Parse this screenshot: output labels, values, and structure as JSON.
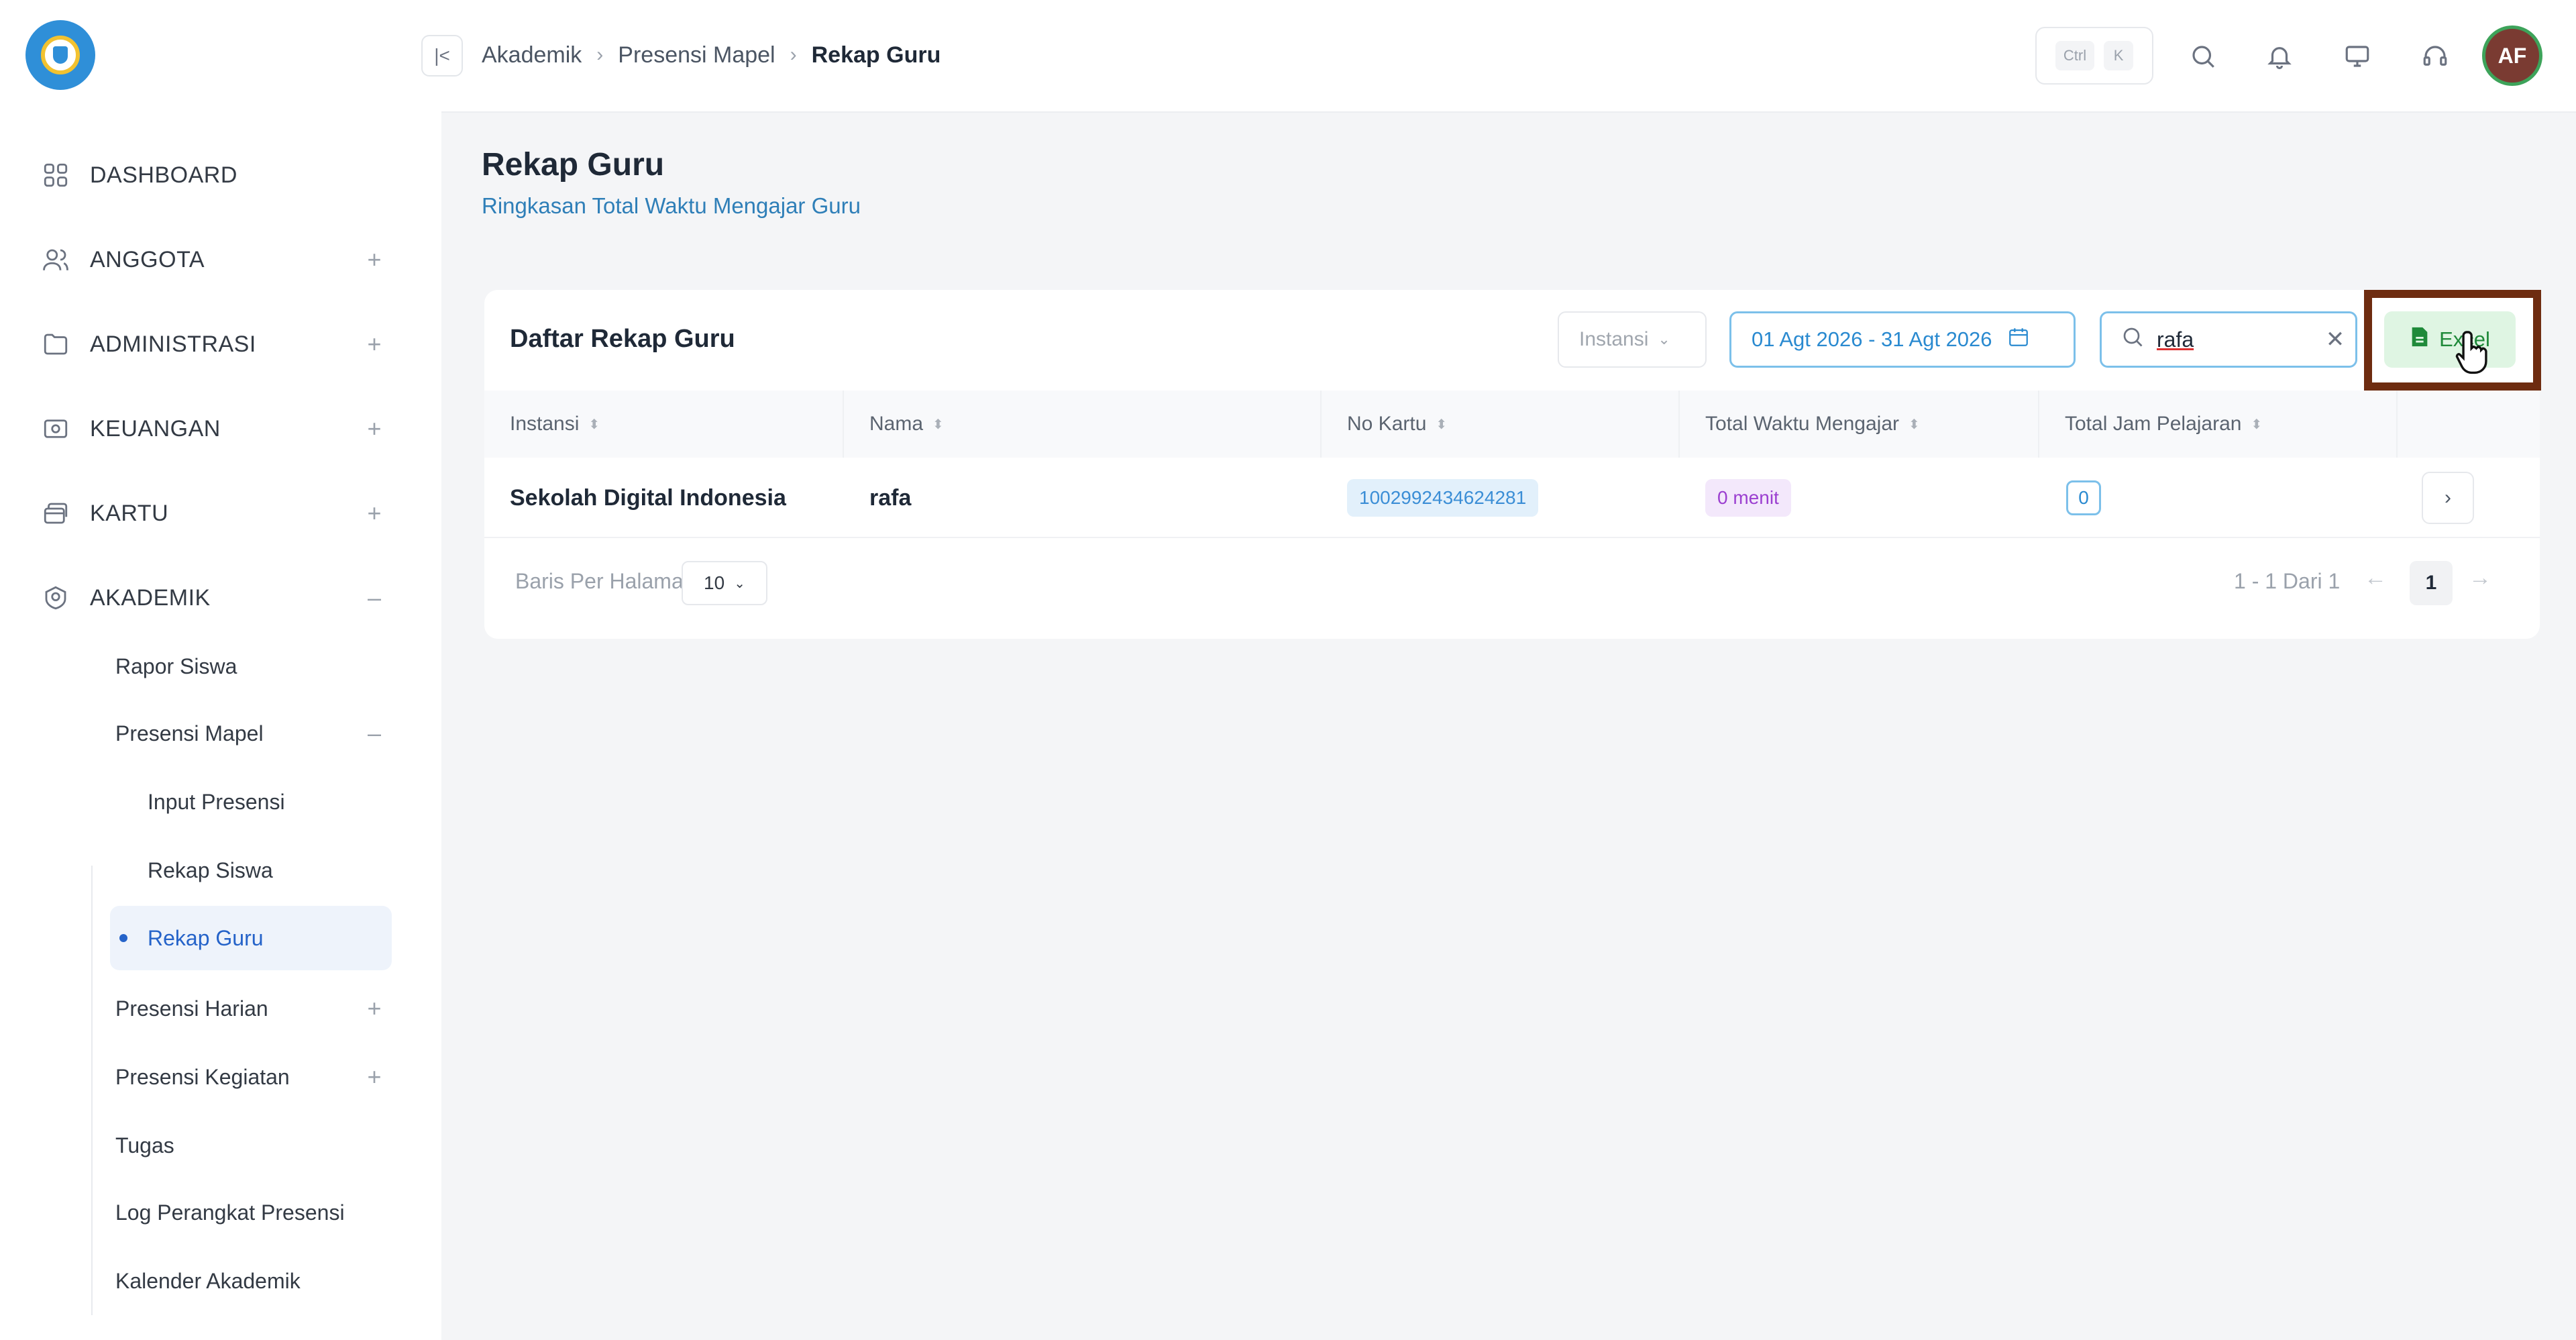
{
  "sidebar": {
    "items": [
      {
        "label": "DASHBOARD",
        "icon": "dashboard-grid-icon"
      },
      {
        "label": "ANGGOTA",
        "icon": "users-icon",
        "toggle": "+"
      },
      {
        "label": "ADMINISTRASI",
        "icon": "folder-icon",
        "toggle": "+"
      },
      {
        "label": "KEUANGAN",
        "icon": "wallet-icon",
        "toggle": "+"
      },
      {
        "label": "KARTU",
        "icon": "cards-icon",
        "toggle": "+"
      },
      {
        "label": "AKADEMIK",
        "icon": "academic-icon",
        "toggle": "–"
      }
    ],
    "akademik_sub": [
      {
        "label": "Rapor Siswa"
      },
      {
        "label": "Presensi Mapel",
        "toggle": "–"
      },
      {
        "label": "Input Presensi"
      },
      {
        "label": "Rekap Siswa"
      },
      {
        "label": "Rekap Guru",
        "active": true
      },
      {
        "label": "Presensi Harian",
        "toggle": "+"
      },
      {
        "label": "Presensi Kegiatan",
        "toggle": "+"
      },
      {
        "label": "Tugas"
      },
      {
        "label": "Log Perangkat Presensi"
      },
      {
        "label": "Kalender Akademik"
      }
    ]
  },
  "header": {
    "breadcrumb": [
      "Akademik",
      "Presensi Mapel",
      "Rekap Guru"
    ],
    "shortcut_keys": [
      "Ctrl",
      "K"
    ],
    "avatar_initials": "AF"
  },
  "page": {
    "title": "Rekap Guru",
    "subtitle": "Ringkasan Total Waktu Mengajar Guru"
  },
  "card": {
    "title": "Daftar Rekap Guru",
    "instansi_placeholder": "Instansi",
    "date_range": "01 Agt 2026 - 31 Agt 2026",
    "search_value": "rafa",
    "excel_label": "Excel"
  },
  "table": {
    "columns": [
      "Instansi",
      "Nama",
      "No Kartu",
      "Total Waktu Mengajar",
      "Total Jam Pelajaran"
    ],
    "rows": [
      {
        "instansi": "Sekolah Digital Indonesia",
        "nama": "rafa",
        "no_kartu": "1002992434624281",
        "total_waktu": "0 menit",
        "total_jam": "0"
      }
    ]
  },
  "pagination": {
    "per_page_label": "Baris Per Halaman",
    "per_page_value": "10",
    "info": "1 - 1 Dari 1",
    "current_page": "1"
  },
  "colors": {
    "accent_blue": "#2a8ad0",
    "excel_green": "#1f8a3a",
    "highlight_border": "#6e2c10",
    "avatar_bg": "#7a3b32"
  }
}
